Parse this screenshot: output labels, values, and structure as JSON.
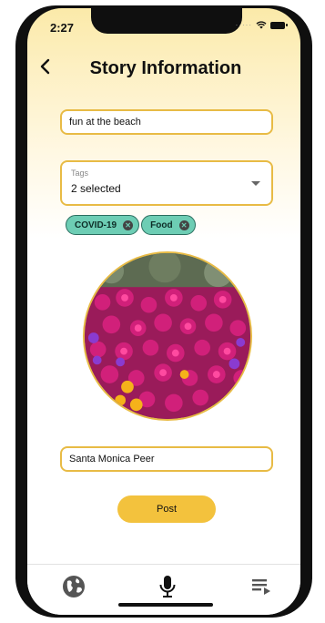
{
  "status_bar": {
    "time": "2:27",
    "signal_dots": "·····"
  },
  "header": {
    "title": "Story Information",
    "back_icon": "chevron-left-icon"
  },
  "form": {
    "story_title": "fun at the beach",
    "tags": {
      "label": "Tags",
      "value": "2 selected",
      "selected": [
        {
          "label": "COVID-19"
        },
        {
          "label": "Food"
        }
      ]
    },
    "location": "Santa Monica Peer",
    "post_label": "Post"
  },
  "tab_bar": {
    "items": [
      {
        "icon": "globe-icon"
      },
      {
        "icon": "microphone-icon"
      },
      {
        "icon": "playlist-icon"
      }
    ]
  },
  "colors": {
    "accent": "#f3c23d",
    "border": "#e8bb45",
    "chip": "#6dcdb4"
  }
}
